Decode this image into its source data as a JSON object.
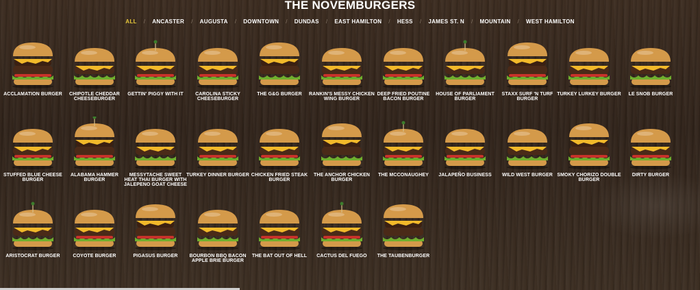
{
  "page": {
    "title": "THE NOVEMBURGERS"
  },
  "nav": {
    "items": [
      {
        "label": "ALL",
        "active": true
      },
      {
        "label": "ANCASTER",
        "active": false
      },
      {
        "label": "AUGUSTA",
        "active": false
      },
      {
        "label": "DOWNTOWN",
        "active": false
      },
      {
        "label": "DUNDAS",
        "active": false
      },
      {
        "label": "EAST HAMILTON",
        "active": false
      },
      {
        "label": "HESS",
        "active": false
      },
      {
        "label": "JAMES ST. N",
        "active": false
      },
      {
        "label": "MOUNTAIN",
        "active": false
      },
      {
        "label": "WEST HAMILTON",
        "active": false
      }
    ],
    "separator": "/"
  },
  "burgers": [
    {
      "label": "ACCLAMATION BURGER"
    },
    {
      "label": "CHIPOTLE CHEDDAR CHEESEBURGER"
    },
    {
      "label": "GETTIN' PIGGY WITH IT"
    },
    {
      "label": "CAROLINA STICKY CHEESEBURGER"
    },
    {
      "label": "THE G&G BURGER"
    },
    {
      "label": "RANKIN'S MESSY CHICKEN WING BURGER"
    },
    {
      "label": "DEEP FRIED POUTINE BACON BURGER"
    },
    {
      "label": "HOUSE OF PARLIAMENT BURGER"
    },
    {
      "label": "STAXX SURF 'N TURF BURGER"
    },
    {
      "label": "TURKEY LURKEY BURGER"
    },
    {
      "label": "LE SNOB BURGER"
    },
    {
      "label": "STUFFED BLUE CHEESE BURGER"
    },
    {
      "label": "ALABAMA HAMMER BURGER"
    },
    {
      "label": "MESSYTACHE SWEET HEAT THAI BURGER WITH JALEPENO GOAT CHEESE"
    },
    {
      "label": "TURKEY DINNER BURGER"
    },
    {
      "label": "CHICKEN FRIED STEAK BURGER"
    },
    {
      "label": "THE ANCHOR CHICKEN BURGER"
    },
    {
      "label": "THE MCCONAUGHEY"
    },
    {
      "label": "JALAPEÑO BUSINESS"
    },
    {
      "label": "WILD WEST BURGER"
    },
    {
      "label": "SMOKY CHORIZO DOUBLE BURGER"
    },
    {
      "label": "DIRTY BURGER"
    },
    {
      "label": "ARISTOCRAT BURGER"
    },
    {
      "label": "COYOTE BURGER"
    },
    {
      "label": "PIGASUS BURGER"
    },
    {
      "label": "BOURBON BBQ BACON APPLE BRIE BURGER"
    },
    {
      "label": "THE BAT OUT OF HELL"
    },
    {
      "label": "CACTUS DEL FUEGO"
    },
    {
      "label": "THE TAUBENBURGER"
    }
  ],
  "colors": {
    "accent": "#e6c73a",
    "bun": "#d49a4a",
    "patty": "#4a2a18",
    "lettuce": "#6fae2e",
    "cheese": "#f2b92a",
    "tomato": "#c8322a"
  }
}
